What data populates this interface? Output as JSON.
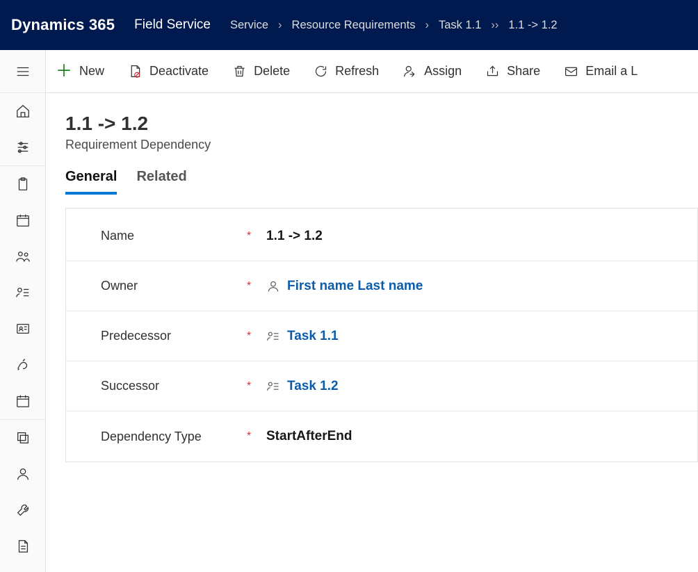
{
  "header": {
    "brand": "Dynamics 365",
    "subtitle": "Field Service",
    "breadcrumb": {
      "area": "Service",
      "middle": "Resource Requirements",
      "parent": "Task 1.1",
      "current": "1.1 -> 1.2"
    }
  },
  "commands": {
    "new": "New",
    "deactivate": "Deactivate",
    "delete": "Delete",
    "refresh": "Refresh",
    "assign": "Assign",
    "share": "Share",
    "email": "Email a L"
  },
  "record": {
    "title": "1.1 -> 1.2",
    "entity": "Requirement Dependency"
  },
  "tabs": {
    "general": "General",
    "related": "Related"
  },
  "form": {
    "name_label": "Name",
    "name_value": "1.1 -> 1.2",
    "owner_label": "Owner",
    "owner_value": "First name Last name",
    "predecessor_label": "Predecessor",
    "predecessor_value": "Task 1.1",
    "successor_label": "Successor",
    "successor_value": "Task 1.2",
    "deptype_label": "Dependency Type",
    "deptype_value": "StartAfterEnd"
  }
}
